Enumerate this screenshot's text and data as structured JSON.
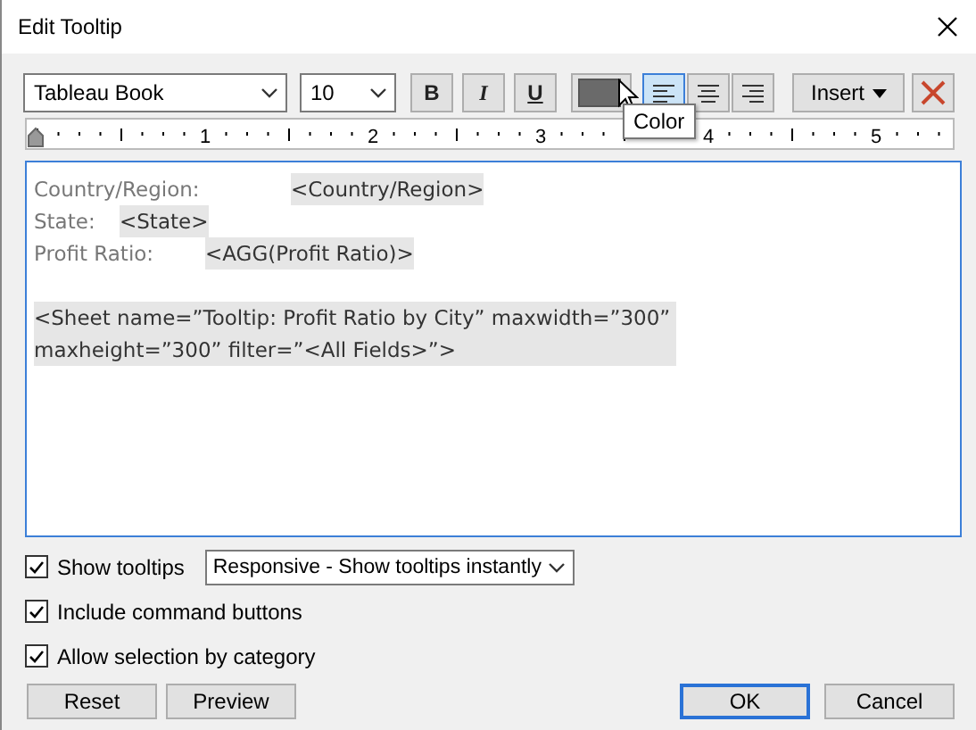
{
  "window": {
    "title": "Edit Tooltip"
  },
  "toolbar": {
    "font": "Tableau Book",
    "size": "10",
    "format": [
      {
        "kind": "bold",
        "label": "B"
      },
      {
        "kind": "italic",
        "label": "I"
      },
      {
        "kind": "underline",
        "label": "U"
      }
    ],
    "align": [
      {
        "kind": "left",
        "selected": true
      },
      {
        "kind": "center",
        "selected": false
      },
      {
        "kind": "right",
        "selected": false
      }
    ],
    "color_tooltip": "Color",
    "insert": "Insert"
  },
  "ruler": {
    "labels": [
      "1",
      "2",
      "3",
      "4",
      "5"
    ]
  },
  "editor": {
    "paragraphs": [
      {
        "kind": "line",
        "segments": [
          {
            "kind": "label",
            "text": "Country/Region:"
          },
          {
            "kind": "field",
            "text": "<Country/Region>"
          }
        ]
      },
      {
        "kind": "line",
        "segments": [
          {
            "kind": "label",
            "text": "State:"
          },
          {
            "kind": "field",
            "text": "<State>"
          }
        ]
      },
      {
        "kind": "line",
        "segments": [
          {
            "kind": "label",
            "text": "Profit Ratio:"
          },
          {
            "kind": "field",
            "text": "<AGG(Profit Ratio)>"
          }
        ]
      },
      {
        "kind": "sheet",
        "segments": [
          {
            "kind": "field",
            "text": "<Sheet name=”Tooltip: Profit Ratio by City” maxwidth=”300” maxheight=”300” filter=”<All Fields>”>"
          }
        ]
      }
    ]
  },
  "options": [
    {
      "label": "Show tooltips",
      "checked": true,
      "dropdown": "Responsive - Show tooltips instantly"
    },
    {
      "label": "Include command buttons",
      "checked": true
    },
    {
      "label": "Allow selection by category",
      "checked": true
    }
  ],
  "buttons_left": [
    "Reset",
    "Preview"
  ],
  "buttons_right": [
    {
      "label": "OK",
      "default": true
    },
    {
      "label": "Cancel",
      "default": false
    }
  ]
}
